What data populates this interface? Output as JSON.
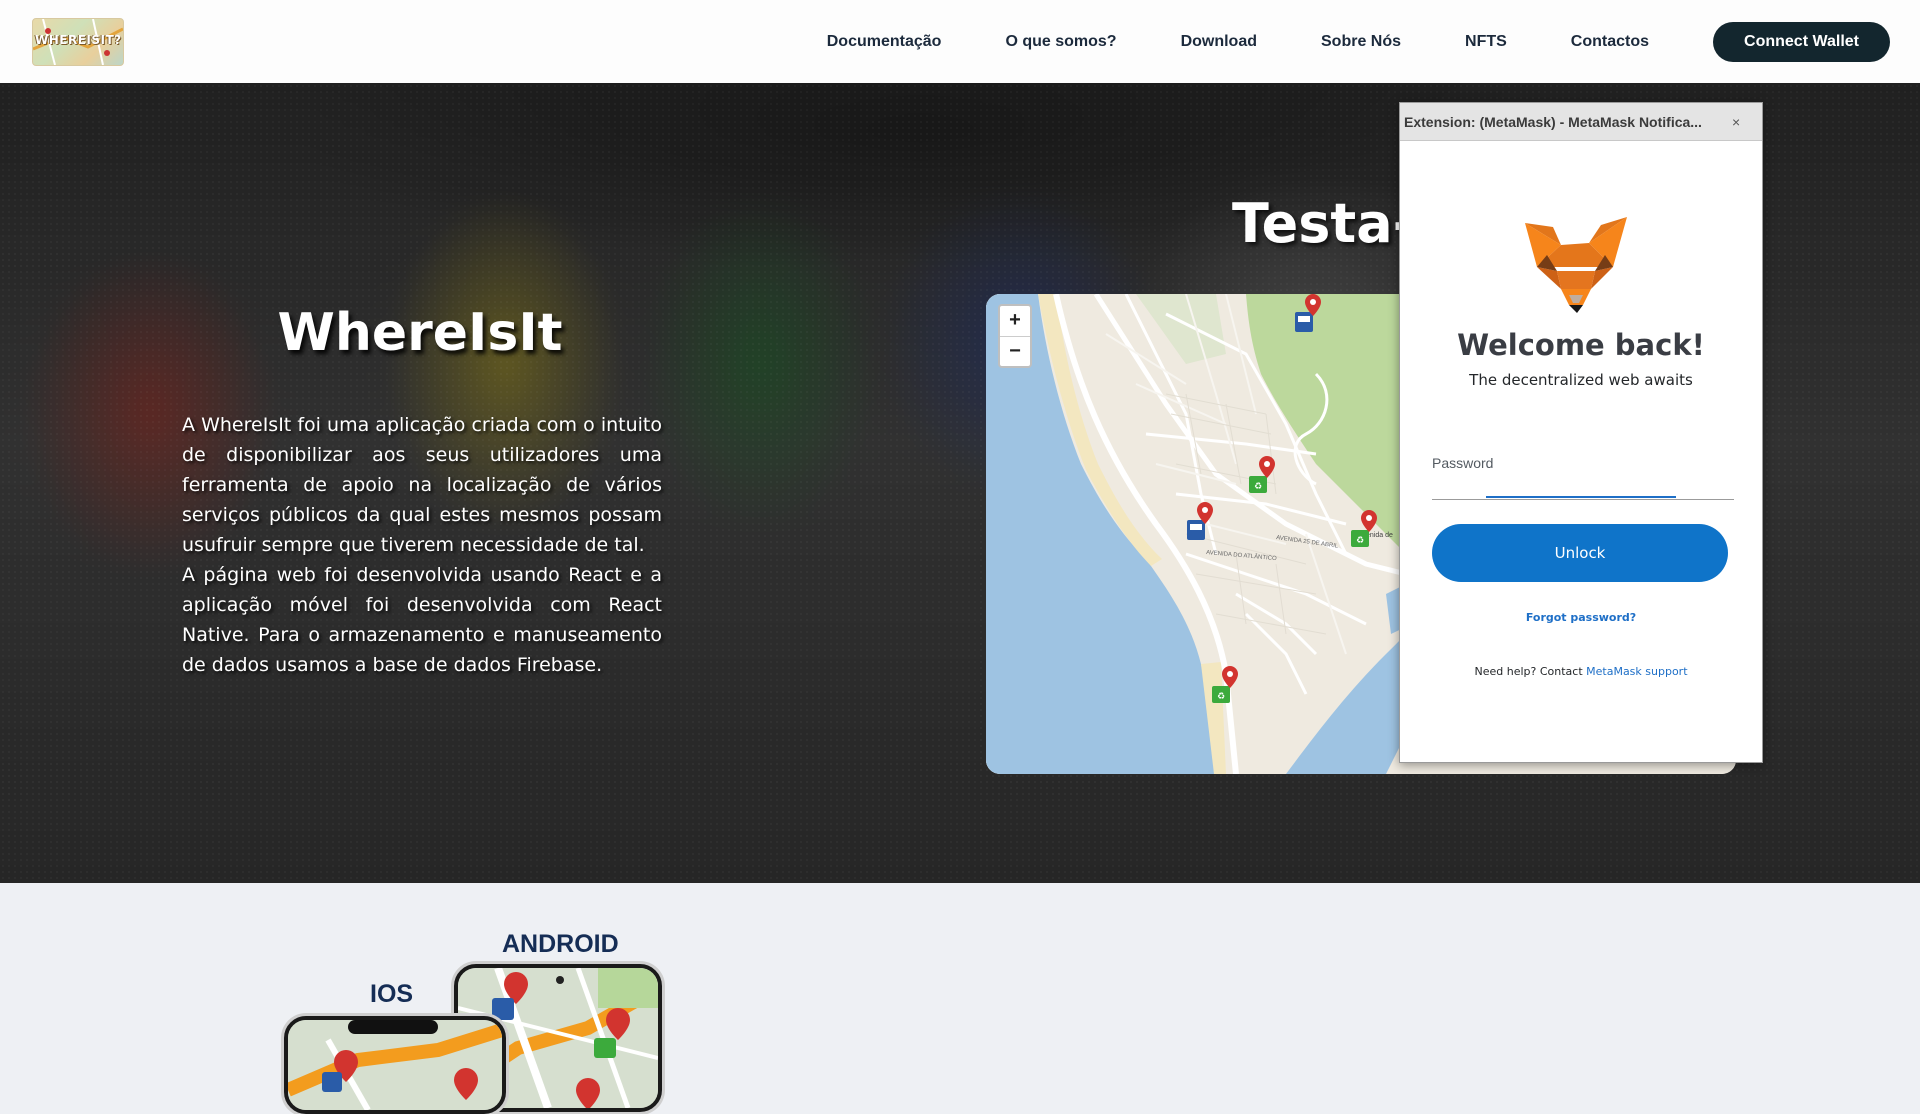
{
  "header": {
    "logo_text": "WHEREISIT?",
    "nav": [
      "Documentação",
      "O que somos?",
      "Download",
      "Sobre Nós",
      "NFTS",
      "Contactos"
    ],
    "connect_wallet": "Connect Wallet"
  },
  "hero": {
    "title": "WhereIsIt",
    "paragraph_1": "A WhereIsIt foi uma aplicação criada com o intuito de disponibilizar aos seus utilizadores uma ferramenta de apoio na localização de vários serviços públicos da qual estes mesmos possam usufruir sempre que tiverem necessidade de tal.",
    "paragraph_2": "A página web foi desenvolvida usando React e a aplicação móvel foi desenvolvida com React Native. Para o armazenamento e manuseamento de dados usamos a base de dados Firebase.",
    "map_heading": "Testa-"
  },
  "map": {
    "zoom_in": "+",
    "zoom_out": "−",
    "street_labels": [
      "AVENIDA DO ATLÂNTICO",
      "AVENIDA 25 DE ABRIL",
      "Avenida de"
    ],
    "markers": [
      "trash-bin-blue",
      "recycling-bin-green",
      "recycling-bin-green",
      "trash-bin-blue",
      "recycling-bin-green",
      "recycling-bin-green"
    ]
  },
  "metamask": {
    "window_title": "Extension: (MetaMask) - MetaMask Notifica...",
    "close": "×",
    "welcome": "Welcome back!",
    "subtitle": "The decentralized web awaits",
    "password_label": "Password",
    "unlock": "Unlock",
    "forgot": "Forgot password?",
    "help_prefix": "Need help? Contact ",
    "help_link": "MetaMask support"
  },
  "download": {
    "android_label": "ANDROID",
    "ios_label": "IOS"
  },
  "colors": {
    "header_bg": "#fdfdfd",
    "nav_text": "#1c2a3c",
    "connect_btn": "#13262e",
    "unlock_btn": "#0f74c9",
    "link_blue": "#1e6fc7",
    "store_label": "#152d55",
    "water": "#9ec3e2",
    "park": "#bcd89c"
  }
}
